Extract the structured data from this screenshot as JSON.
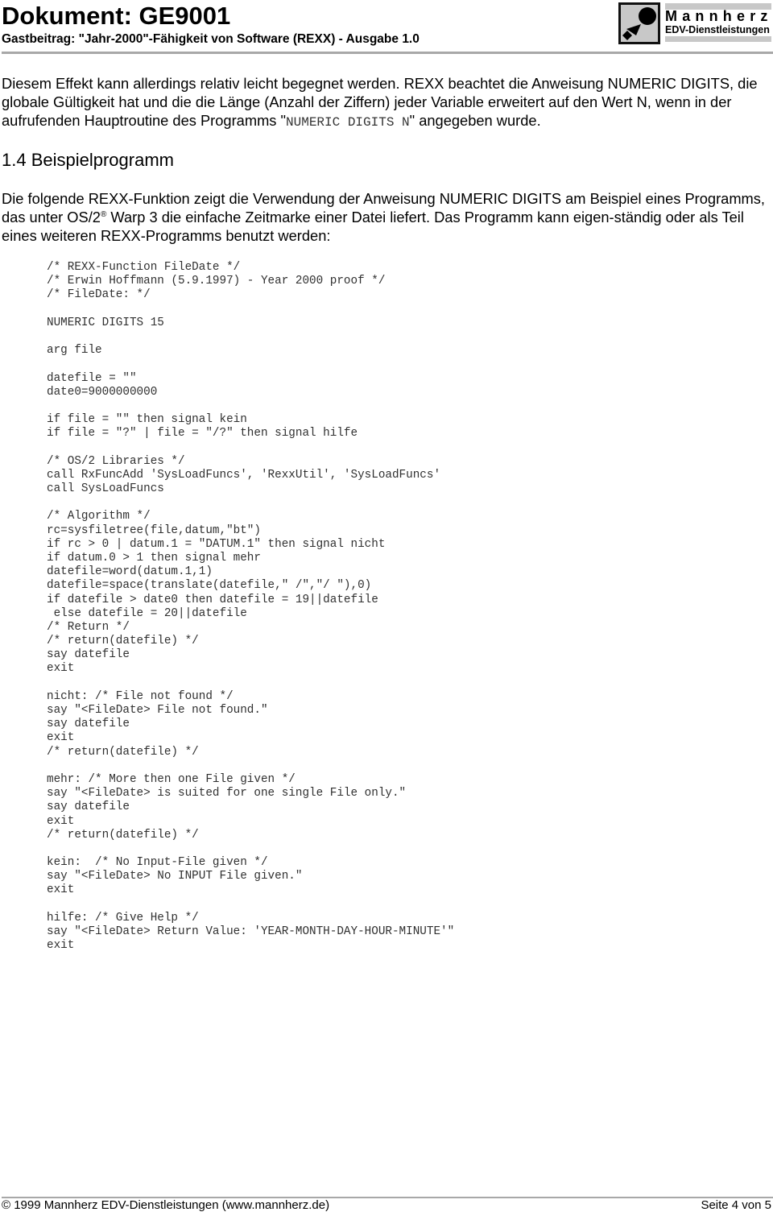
{
  "header": {
    "title": "Dokument: GE9001",
    "subtitle": "Gastbeitrag: \"Jahr-2000\"-Fähigkeit von Software (REXX) - Ausgabe 1.0",
    "brand": {
      "name": "Mannherz",
      "tagline": "EDV-Dienstleistungen",
      "logo_icon": "mannherz-logo-icon"
    }
  },
  "intro": {
    "text_before_code": "Diesem Effekt kann allerdings relativ leicht begegnet werden. REXX beachtet die Anweisung NUMERIC DIGITS, die globale Gültigkeit hat und die die Länge (Anzahl der Ziffern) jeder Variable erweitert auf den Wert N, wenn in der aufrufenden Hauptroutine des Programms \"",
    "inline_code": "NUMERIC DIGITS N",
    "text_after_code": "\" angegeben wurde."
  },
  "section": {
    "heading": "1.4 Beispielprogramm",
    "para_part1": "Die folgende REXX-Funktion zeigt die Verwendung der Anweisung NUMERIC DIGITS am Beispiel eines Programms, das unter OS/2",
    "registered_mark": "®",
    "para_part2": " Warp 3 die einfache Zeitmarke einer Datei liefert. Das Programm kann eigen-ständig oder als Teil eines weiteren REXX-Programms benutzt werden:"
  },
  "code_lines": [
    "/* REXX-Function FileDate */",
    "/* Erwin Hoffmann (5.9.1997) - Year 2000 proof */",
    "/* FileDate: */",
    "",
    "NUMERIC DIGITS 15",
    "",
    "arg file",
    "",
    "datefile = \"\"",
    "date0=9000000000",
    "",
    "if file = \"\" then signal kein",
    "if file = \"?\" | file = \"/?\" then signal hilfe",
    "",
    "/* OS/2 Libraries */",
    "call RxFuncAdd 'SysLoadFuncs', 'RexxUtil', 'SysLoadFuncs'",
    "call SysLoadFuncs",
    "",
    "/* Algorithm */",
    "rc=sysfiletree(file,datum,\"bt\")",
    "if rc > 0 | datum.1 = \"DATUM.1\" then signal nicht",
    "if datum.0 > 1 then signal mehr",
    "datefile=word(datum.1,1)",
    "datefile=space(translate(datefile,\" /\",\"/ \"),0)",
    "if datefile > date0 then datefile = 19||datefile",
    " else datefile = 20||datefile",
    "/* Return */",
    "/* return(datefile) */",
    "say datefile",
    "exit",
    "",
    "nicht: /* File not found */",
    "say \"<FileDate> File not found.\"",
    "say datefile",
    "exit",
    "/* return(datefile) */",
    "",
    "mehr: /* More then one File given */",
    "say \"<FileDate> is suited for one single File only.\"",
    "say datefile",
    "exit",
    "/* return(datefile) */",
    "",
    "kein:  /* No Input-File given */",
    "say \"<FileDate> No INPUT File given.\"",
    "exit",
    "",
    "hilfe: /* Give Help */",
    "say \"<FileDate> Return Value: 'YEAR-MONTH-DAY-HOUR-MINUTE'\"",
    "exit"
  ],
  "footer": {
    "copyright": "© 1999 Mannherz EDV-Dienstleistungen (www.mannherz.de)",
    "page": "Seite 4 von 5"
  }
}
